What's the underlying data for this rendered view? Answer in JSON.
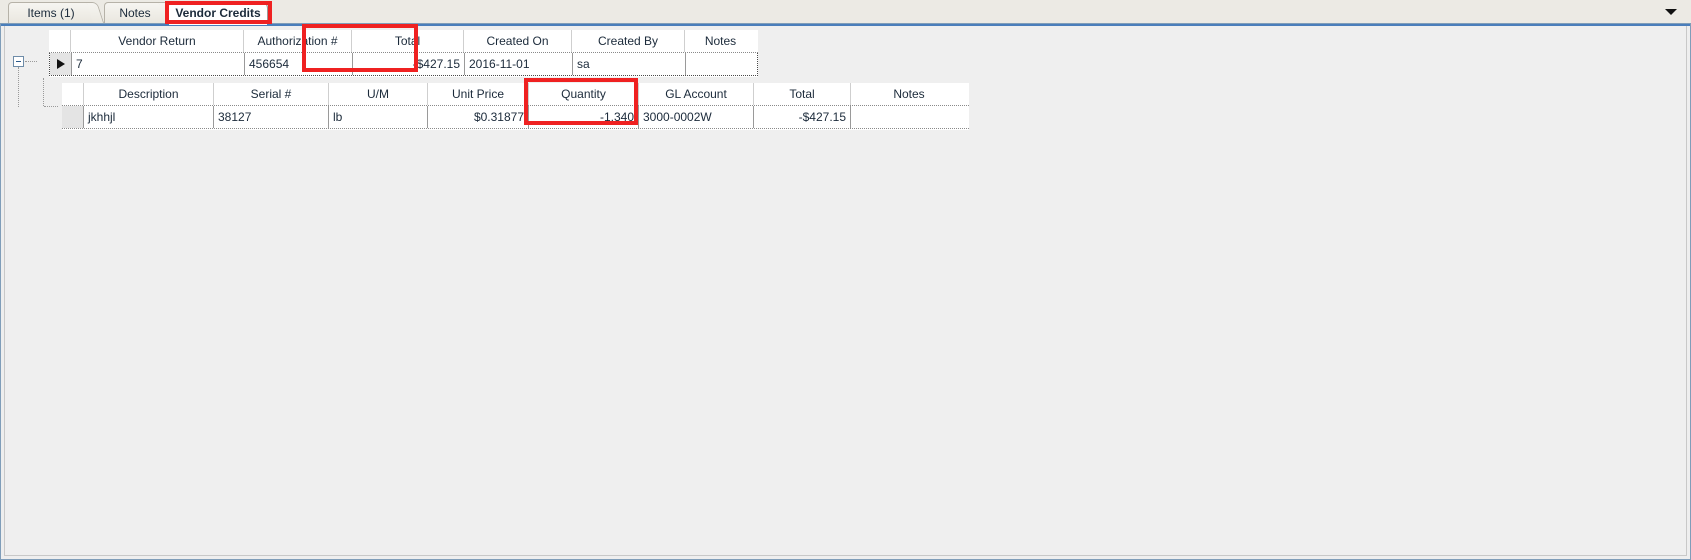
{
  "tabs": [
    {
      "label": "Items (1)",
      "active": false
    },
    {
      "label": "Notes",
      "active": false
    },
    {
      "label": "Vendor Credits",
      "active": true
    }
  ],
  "toolbar": {
    "dropdown_icon": "chevron-down-icon"
  },
  "parent_grid": {
    "name": "vendor-credits-grid",
    "columns": [
      "Vendor Return",
      "Authorization #",
      "Total",
      "Created On",
      "Created By",
      "Notes"
    ],
    "rows": [
      {
        "vendor_return": "7",
        "authorization": "456654",
        "total": "-$427.15",
        "created_on": "2016-11-01",
        "created_by": "sa",
        "notes": ""
      }
    ]
  },
  "child_grid": {
    "name": "vendor-credit-detail-grid",
    "columns": [
      "Description",
      "Serial #",
      "U/M",
      "Unit Price",
      "Quantity",
      "GL Account",
      "Total",
      "Notes"
    ],
    "rows": [
      {
        "description": "jkhhjl",
        "serial": "38127",
        "um": "lb",
        "unit_price": "$0.31877",
        "quantity": "-1,340",
        "gl_account": "3000-0002W",
        "total": "-$427.15",
        "notes": ""
      }
    ]
  },
  "annotations": {
    "color": "#ef2121",
    "boxes": [
      "vendor-credits-tab",
      "parent-total-column",
      "child-quantity-column"
    ]
  },
  "tree": {
    "expander_state": "expanded",
    "expander_glyph": "minus-box-icon",
    "row_indicator_glyph": "right-triangle-icon"
  }
}
